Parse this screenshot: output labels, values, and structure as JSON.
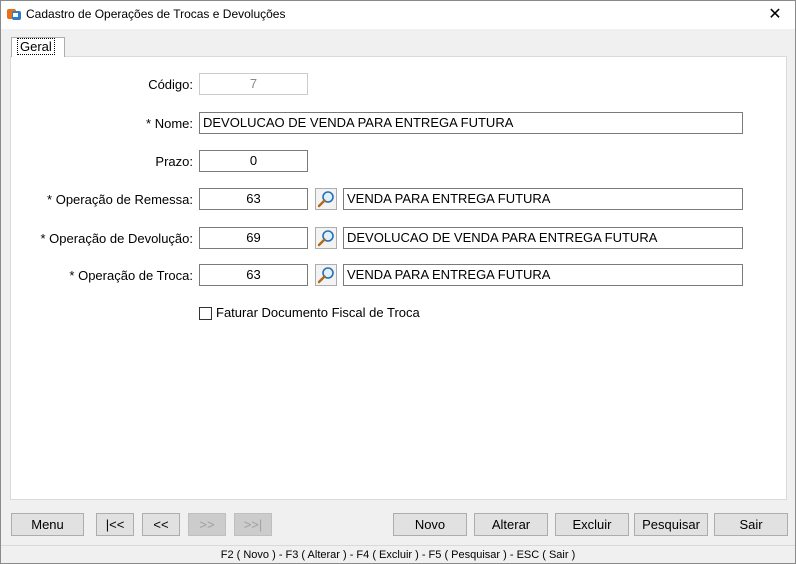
{
  "window": {
    "title": "Cadastro de Operações de Trocas e Devoluções",
    "close_glyph": "✕"
  },
  "tabs": [
    {
      "label": "Geral"
    }
  ],
  "form": {
    "codigo": {
      "label": "Código:",
      "value": "7"
    },
    "nome": {
      "label": "* Nome:",
      "value": "DEVOLUCAO DE VENDA PARA ENTREGA FUTURA"
    },
    "prazo": {
      "label": "Prazo:",
      "value": "0"
    },
    "remessa": {
      "label": "* Operação de Remessa:",
      "code": "63",
      "description": "VENDA PARA ENTREGA FUTURA"
    },
    "devolucao": {
      "label": "* Operação de Devolução:",
      "code": "69",
      "description": "DEVOLUCAO DE VENDA PARA ENTREGA FUTURA"
    },
    "troca": {
      "label": "* Operação de Troca:",
      "code": "63",
      "description": "VENDA PARA ENTREGA FUTURA"
    },
    "faturar": {
      "label": "Faturar Documento Fiscal de Troca",
      "checked": false
    }
  },
  "buttons": {
    "menu": "Menu",
    "first": "|<<",
    "prev": "<<",
    "next": ">>",
    "last": ">>|",
    "novo": "Novo",
    "alterar": "Alterar",
    "excluir": "Excluir",
    "pesquisar": "Pesquisar",
    "sair": "Sair"
  },
  "status": "F2 ( Novo )  -  F3 ( Alterar )  -  F4 ( Excluir )  -  F5 ( Pesquisar )  -  ESC ( Sair )",
  "icons": {
    "app": "app-logo-icon",
    "lookup": "magnifier-icon",
    "close": "close-icon"
  },
  "colors": {
    "background": "#f0f0f0",
    "panel": "#ffffff",
    "button": "#e1e1e1"
  }
}
